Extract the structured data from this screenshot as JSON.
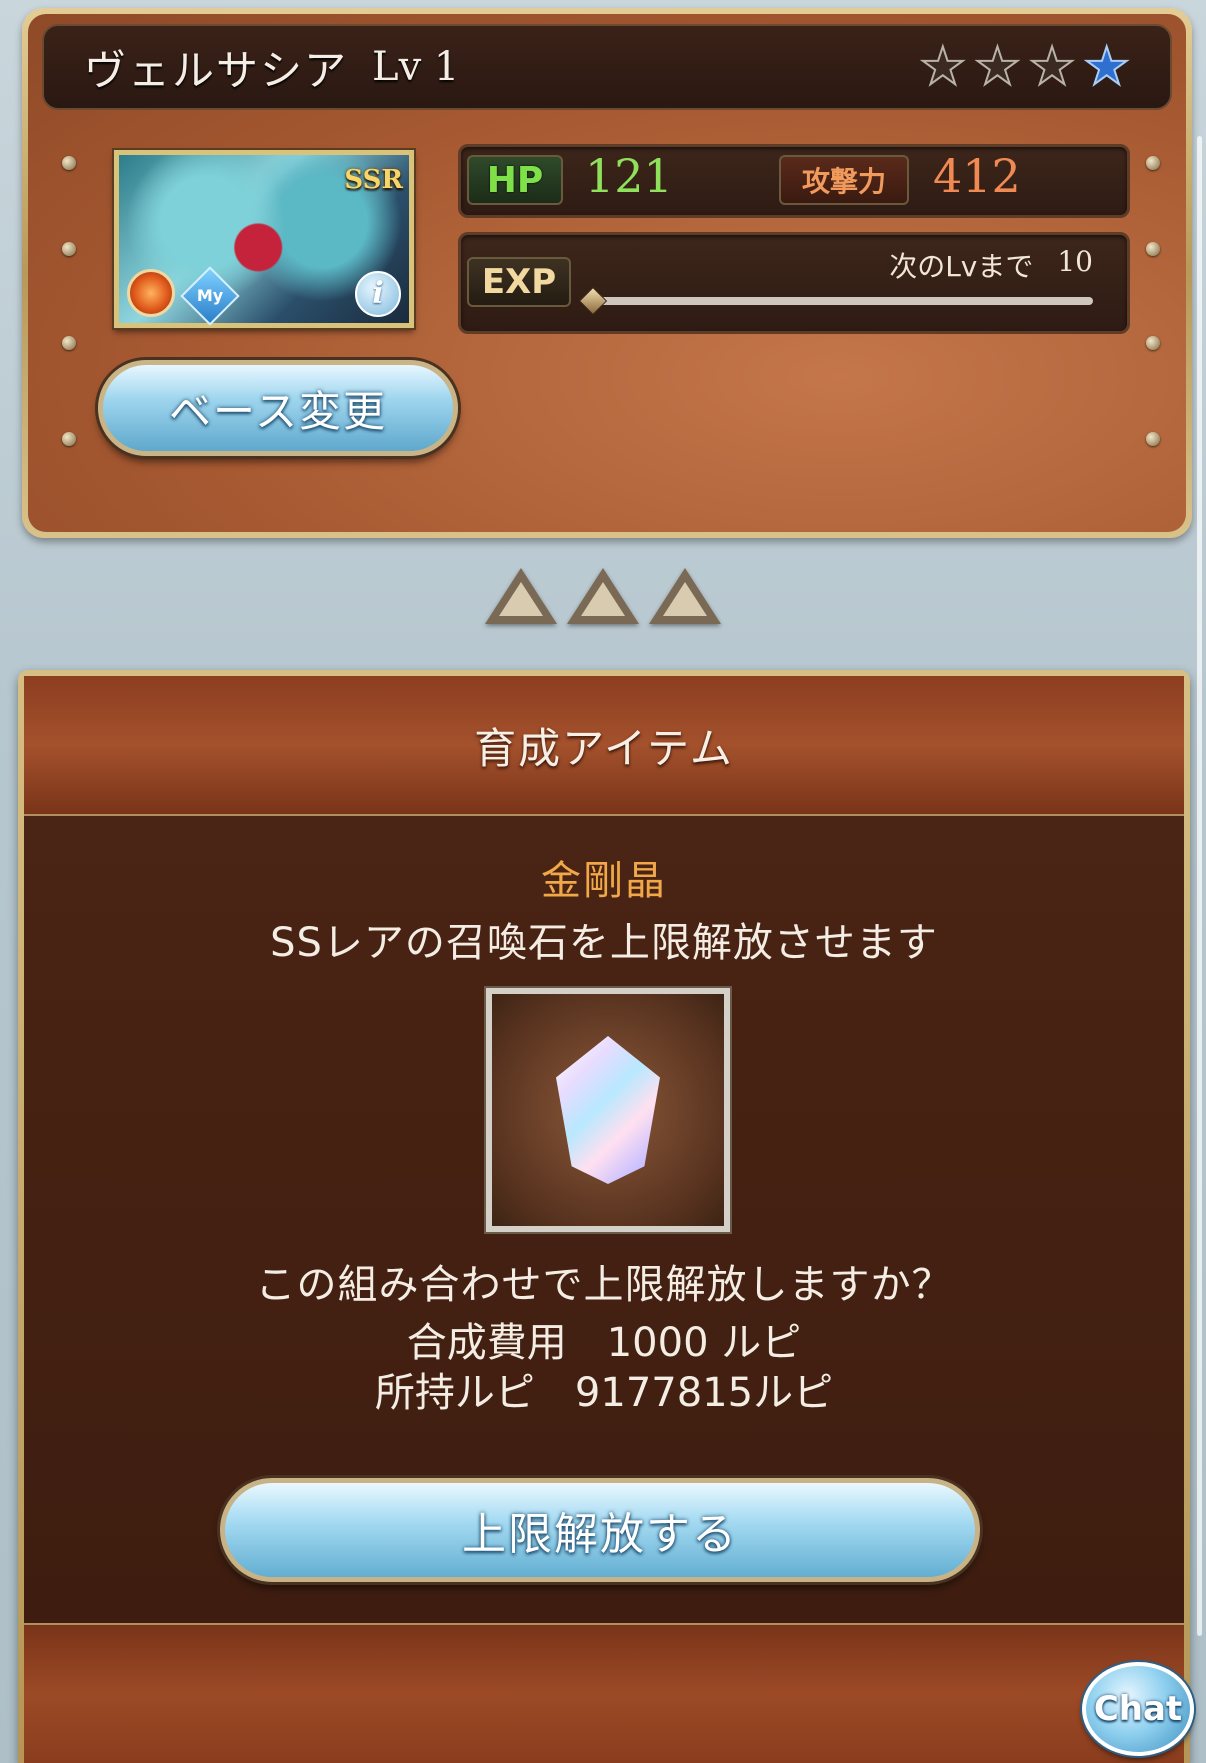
{
  "character": {
    "name": "ヴェルサシア",
    "level": "Lv 1",
    "rarity": "SSR",
    "stars_total": 4,
    "stars_filled_blue": 1,
    "element_icon": "fire-element-icon",
    "my_badge": "My",
    "info_label": "i"
  },
  "stats": {
    "hp_label": "HP",
    "hp_value": "121",
    "attack_label": "攻撃力",
    "attack_value": "412",
    "exp_label": "EXP",
    "next_level_label": "次のLvまで",
    "next_level_value": "10",
    "exp_progress": 0.0
  },
  "buttons": {
    "base_change": "ベース変更",
    "limit_break": "上限解放する",
    "chat": "Chat"
  },
  "section": {
    "title": "育成アイテム"
  },
  "item": {
    "name": "金剛晶",
    "description": "SSレアの召喚石を上限解放させます",
    "icon": "crystal-icon"
  },
  "confirm": {
    "question": "この組み合わせで上限解放しますか？",
    "cost_label": "合成費用",
    "cost_value": "1000 ルピ",
    "owned_label": "所持ルピ",
    "owned_value": "9177815ルピ"
  },
  "colors": {
    "hp_green": "#8fe05a",
    "attack_orange": "#f08a52",
    "item_name_gold": "#f0a848",
    "button_blue": "#9ed5ee",
    "panel_brown": "#a85a32"
  }
}
